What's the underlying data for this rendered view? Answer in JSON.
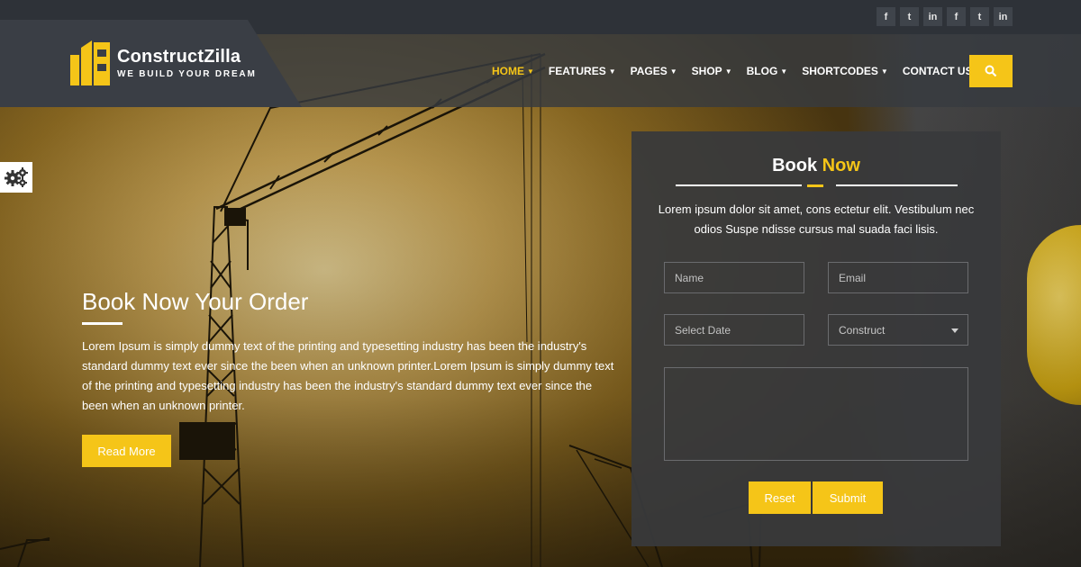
{
  "brand": {
    "name": "ConstructZilla",
    "tagline": "WE BUILD YOUR DREAM",
    "accent_color": "#f5c518"
  },
  "social": [
    {
      "icon": "facebook-icon",
      "glyph": "f"
    },
    {
      "icon": "twitter-icon",
      "glyph": "t"
    },
    {
      "icon": "linkedin-icon",
      "glyph": "in"
    },
    {
      "icon": "facebook-icon",
      "glyph": "f"
    },
    {
      "icon": "twitter-icon",
      "glyph": "t"
    },
    {
      "icon": "linkedin-icon",
      "glyph": "in"
    }
  ],
  "nav": {
    "items": [
      {
        "label": "HOME",
        "active": true
      },
      {
        "label": "FEATURES"
      },
      {
        "label": "PAGES"
      },
      {
        "label": "SHOP"
      },
      {
        "label": "BLOG"
      },
      {
        "label": "SHORTCODES"
      },
      {
        "label": "CONTACT US"
      }
    ],
    "search_icon": "search-icon"
  },
  "hero": {
    "title": "Book Now Your Order",
    "text": "Lorem Ipsum is simply dummy text of the printing and typesetting industry has been the industry's standard dummy text ever since the been when an unknown printer.Lorem Ipsum is simply dummy text of the printing and typesetting industry has been the industry's standard dummy text ever since the been when an unknown printer.",
    "button": "Read More"
  },
  "booking": {
    "title_part1": "Book",
    "title_part2": "Now",
    "description": "Lorem ipsum dolor sit amet, cons ectetur elit. Vestibulum nec odios Suspe ndisse cursus mal suada faci lisis.",
    "name_placeholder": "Name",
    "email_placeholder": "Email",
    "date_placeholder": "Select Date",
    "construct_selected": "Construct",
    "reset_label": "Reset",
    "submit_label": "Submit"
  }
}
